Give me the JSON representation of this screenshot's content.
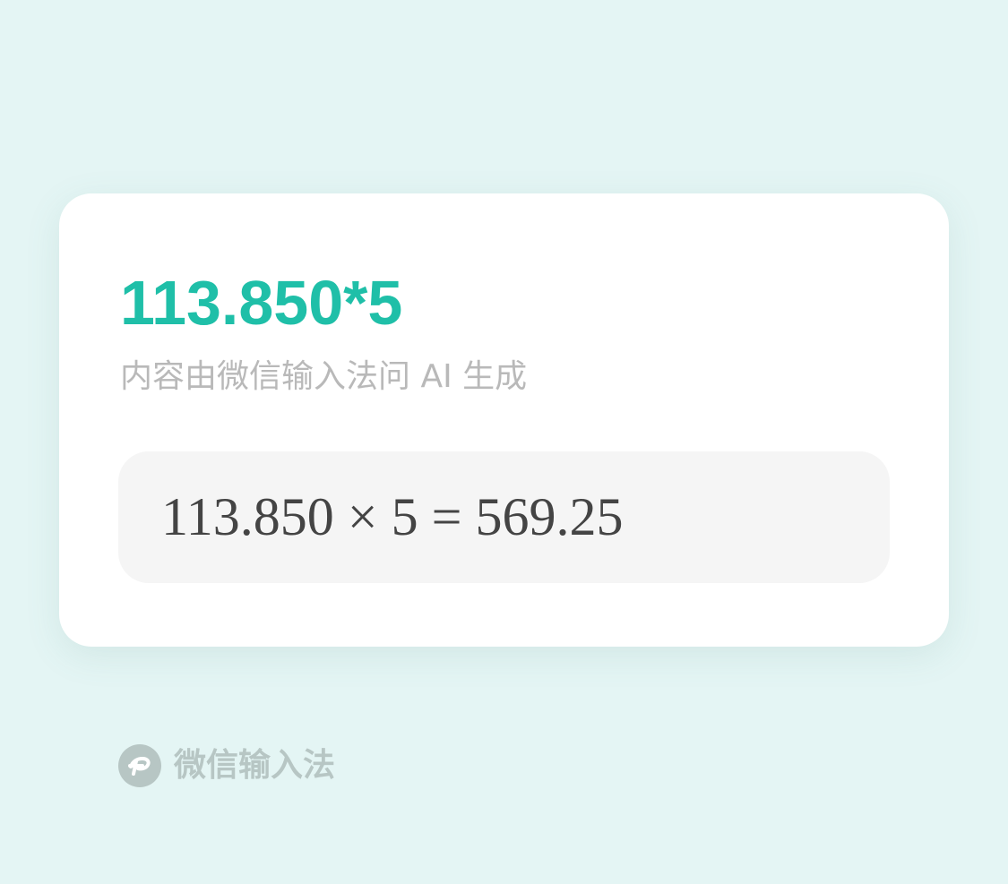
{
  "card": {
    "query": "113.850*5",
    "disclaimer": "内容由微信输入法问 AI 生成",
    "answer": "113.850 × 5 = 569.25"
  },
  "footer": {
    "brand_icon": "wechat-input-method-logo-icon",
    "brand_name": "微信输入法"
  },
  "colors": {
    "background": "#e4f5f4",
    "accent": "#1fbfa8",
    "muted_text": "#b9b9b9",
    "answer_text": "#444444",
    "brand": "#b7c6c4"
  }
}
